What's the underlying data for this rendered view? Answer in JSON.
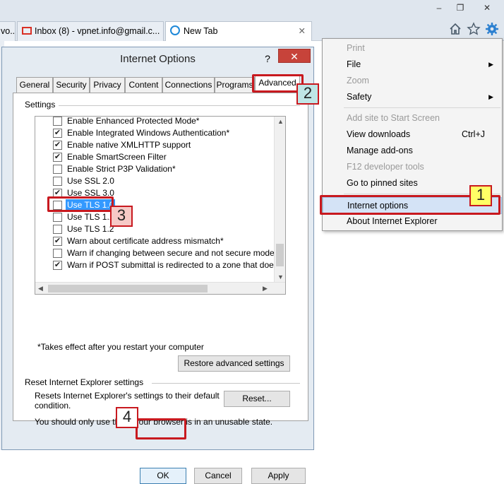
{
  "browser": {
    "window_controls": {
      "minimize": "–",
      "restore": "❐",
      "close": "✕"
    },
    "tabs": [
      {
        "label": "vo..."
      },
      {
        "label": "Inbox (8) - vpnet.info@gmail.c..."
      },
      {
        "label": "New Tab",
        "close": "✕"
      }
    ],
    "toolbar_icons": [
      "home-icon",
      "star-icon",
      "gear-icon"
    ]
  },
  "tools_menu": {
    "items": [
      {
        "label": "Print",
        "disabled": true
      },
      {
        "label": "File",
        "submenu": true
      },
      {
        "label": "Zoom",
        "disabled": true
      },
      {
        "label": "Safety",
        "submenu": true
      },
      {
        "label": "Add site to Start Screen",
        "disabled": true
      },
      {
        "label": "View downloads",
        "shortcut": "Ctrl+J"
      },
      {
        "label": "Manage add-ons"
      },
      {
        "label": "F12 developer tools",
        "disabled": true
      },
      {
        "label": "Go to pinned sites"
      },
      {
        "label": "Internet options",
        "highlighted": true
      },
      {
        "label": "About Internet Explorer"
      }
    ]
  },
  "dialog": {
    "title": "Internet Options",
    "help": "?",
    "close": "✕",
    "tabs": [
      "General",
      "Security",
      "Privacy",
      "Content",
      "Connections",
      "Programs",
      "Advanced"
    ],
    "active_tab": "Advanced",
    "settings_label": "Settings",
    "settings": [
      {
        "label": "Enable Enhanced Protected Mode*",
        "checked": false
      },
      {
        "label": "Enable Integrated Windows Authentication*",
        "checked": true
      },
      {
        "label": "Enable native XMLHTTP support",
        "checked": true
      },
      {
        "label": "Enable SmartScreen Filter",
        "checked": true
      },
      {
        "label": "Enable Strict P3P Validation*",
        "checked": false
      },
      {
        "label": "Use SSL 2.0",
        "checked": false
      },
      {
        "label": "Use SSL 3.0",
        "checked": true
      },
      {
        "label": "Use TLS 1.0",
        "checked": false,
        "selected": true
      },
      {
        "label": "Use TLS 1.1",
        "checked": false
      },
      {
        "label": "Use TLS 1.2",
        "checked": false
      },
      {
        "label": "Warn about certificate address mismatch*",
        "checked": true
      },
      {
        "label": "Warn if changing between secure and not secure mode",
        "checked": false
      },
      {
        "label": "Warn if POST submittal is redirected to a zone that does n",
        "checked": true
      }
    ],
    "restart_note": "*Takes effect after you restart your computer",
    "restore_button": "Restore advanced settings",
    "reset_section_title": "Reset Internet Explorer settings",
    "reset_description": "Resets Internet Explorer's settings to their default condition.",
    "reset_button": "Reset...",
    "unusable_note": "You should only use this if your browser is in an unusable state.",
    "ok_button": "OK",
    "cancel_button": "Cancel",
    "apply_button": "Apply"
  },
  "annotations": {
    "step1": "1",
    "step2": "2",
    "step3": "3",
    "step4": "4",
    "highlight_color": "#c8191f",
    "step1_fill": "#ffff66",
    "step2_fill": "#bfe6e6",
    "step3_fill": "#f6c9c6",
    "step4_fill": "#ffffff"
  }
}
